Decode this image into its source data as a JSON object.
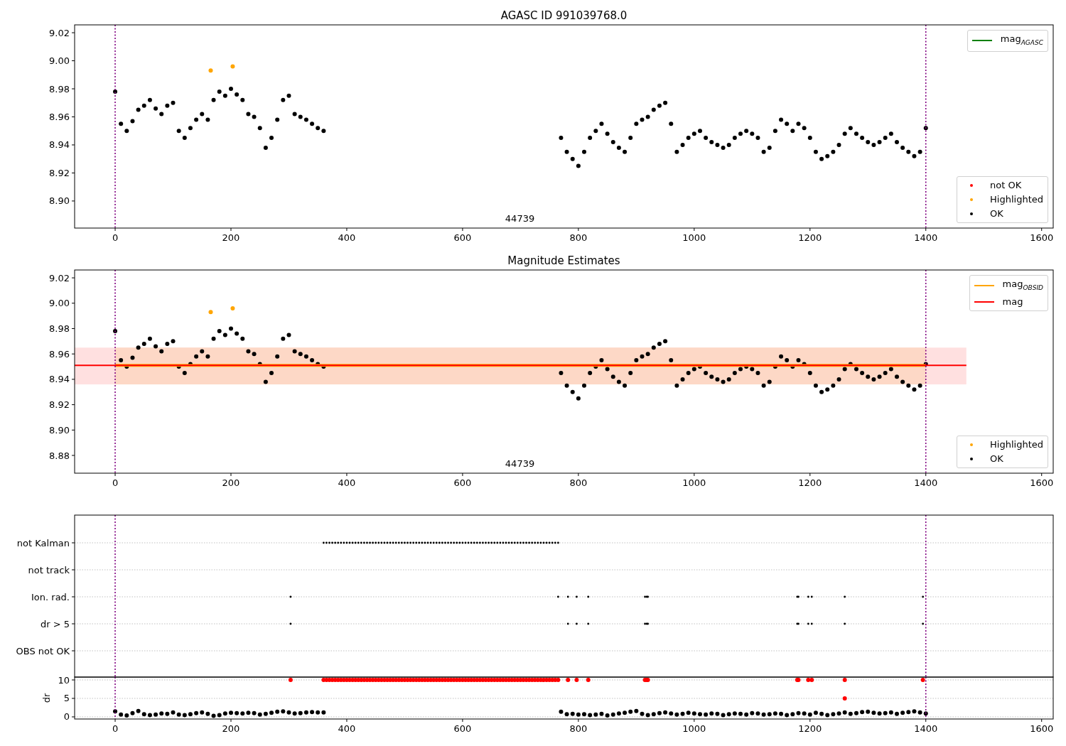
{
  "panels": [
    {
      "kind": "mag",
      "axes": [
        {
          "kind": "mag",
          "chart_data": {
            "type": "scatter",
            "title": "AGASC ID 991039768.0",
            "xlim": [
              -70,
              1620
            ],
            "ylim": [
              8.8807,
              9.0256
            ],
            "xticks": [
              0,
              200,
              400,
              600,
              800,
              1000,
              1200,
              1400,
              1600
            ],
            "yticks": [
              {
                "value": 8.9,
                "label": "8.90"
              },
              {
                "value": 8.92,
                "label": "8.92"
              },
              {
                "value": 8.94,
                "label": "8.94"
              },
              {
                "value": 8.96,
                "label": "8.96"
              },
              {
                "value": 8.98,
                "label": "8.98"
              },
              {
                "value": 9.0,
                "label": "9.00"
              },
              {
                "value": 9.02,
                "label": "9.02"
              }
            ],
            "series": [
              {
                "name": "not OK",
                "type": "scatter",
                "color": "#ff0000"
              },
              {
                "name": "Highlighted",
                "type": "scatter",
                "color": "#ffa500",
                "x": [
                  165,
                  203
                ],
                "values": [
                  8.993,
                  8.996
                ]
              },
              {
                "name": "OK",
                "type": "scatter",
                "color": "#000000",
                "x": [
                  0,
                  10,
                  20,
                  30,
                  40,
                  50,
                  60,
                  70,
                  80,
                  90,
                  100,
                  110,
                  120,
                  130,
                  140,
                  150,
                  160,
                  170,
                  180,
                  190,
                  200,
                  210,
                  220,
                  230,
                  240,
                  250,
                  260,
                  270,
                  280,
                  290,
                  300,
                  310,
                  320,
                  330,
                  340,
                  350,
                  360,
                  770,
                  780,
                  790,
                  800,
                  810,
                  820,
                  830,
                  840,
                  850,
                  860,
                  870,
                  880,
                  890,
                  900,
                  910,
                  920,
                  930,
                  940,
                  950,
                  960,
                  970,
                  980,
                  990,
                  1000,
                  1010,
                  1020,
                  1030,
                  1040,
                  1050,
                  1060,
                  1070,
                  1080,
                  1090,
                  1100,
                  1110,
                  1120,
                  1130,
                  1140,
                  1150,
                  1160,
                  1170,
                  1180,
                  1190,
                  1200,
                  1210,
                  1220,
                  1230,
                  1240,
                  1250,
                  1260,
                  1270,
                  1280,
                  1290,
                  1300,
                  1310,
                  1320,
                  1330,
                  1340,
                  1350,
                  1360,
                  1370,
                  1380,
                  1390,
                  1400
                ],
                "values": [
                  8.978,
                  8.955,
                  8.95,
                  8.957,
                  8.965,
                  8.968,
                  8.972,
                  8.966,
                  8.962,
                  8.968,
                  8.97,
                  8.95,
                  8.945,
                  8.952,
                  8.958,
                  8.962,
                  8.958,
                  8.972,
                  8.978,
                  8.975,
                  8.98,
                  8.976,
                  8.972,
                  8.962,
                  8.96,
                  8.952,
                  8.938,
                  8.945,
                  8.958,
                  8.972,
                  8.975,
                  8.962,
                  8.96,
                  8.958,
                  8.955,
                  8.952,
                  8.95,
                  8.945,
                  8.935,
                  8.93,
                  8.925,
                  8.935,
                  8.945,
                  8.95,
                  8.955,
                  8.948,
                  8.942,
                  8.938,
                  8.935,
                  8.945,
                  8.955,
                  8.958,
                  8.96,
                  8.965,
                  8.968,
                  8.97,
                  8.955,
                  8.935,
                  8.94,
                  8.945,
                  8.948,
                  8.95,
                  8.945,
                  8.942,
                  8.94,
                  8.938,
                  8.94,
                  8.945,
                  8.948,
                  8.95,
                  8.948,
                  8.945,
                  8.935,
                  8.938,
                  8.95,
                  8.958,
                  8.955,
                  8.95,
                  8.955,
                  8.952,
                  8.945,
                  8.935,
                  8.93,
                  8.932,
                  8.935,
                  8.94,
                  8.948,
                  8.952,
                  8.948,
                  8.945,
                  8.942,
                  8.94,
                  8.942,
                  8.945,
                  8.948,
                  8.942,
                  8.938,
                  8.935,
                  8.932,
                  8.935,
                  8.952
                ]
              },
              {
                "name": "mag$_{AGASC}$",
                "type": "line",
                "color": "#008000"
              }
            ],
            "ref_lines": [
              {
                "axis": "x",
                "value": 0
              },
              {
                "axis": "x",
                "value": 1400
              }
            ],
            "annotations": [
              "44739"
            ]
          }
        }
      ]
    },
    {
      "kind": "mag",
      "axes": [
        {
          "kind": "mag",
          "chart_data": {
            "type": "scatter",
            "title": "Magnitude Estimates",
            "xlim": [
              -70,
              1620
            ],
            "ylim": [
              8.866,
              9.0262
            ],
            "xticks": [
              0,
              200,
              400,
              600,
              800,
              1000,
              1200,
              1400,
              1600
            ],
            "yticks": [
              {
                "value": 8.88,
                "label": "8.88"
              },
              {
                "value": 8.9,
                "label": "8.90"
              },
              {
                "value": 8.92,
                "label": "8.92"
              },
              {
                "value": 8.94,
                "label": "8.94"
              },
              {
                "value": 8.96,
                "label": "8.96"
              },
              {
                "value": 8.98,
                "label": "8.98"
              },
              {
                "value": 9.0,
                "label": "9.00"
              },
              {
                "value": 9.02,
                "label": "9.02"
              }
            ],
            "series": [
              {
                "name": "Highlighted",
                "type": "scatter",
                "color": "#ffa500",
                "x": [
                  165,
                  203
                ],
                "values": [
                  8.993,
                  8.996
                ]
              },
              {
                "name": "OK",
                "type": "scatter",
                "color": "#000000",
                "x": [
                  0,
                  10,
                  20,
                  30,
                  40,
                  50,
                  60,
                  70,
                  80,
                  90,
                  100,
                  110,
                  120,
                  130,
                  140,
                  150,
                  160,
                  170,
                  180,
                  190,
                  200,
                  210,
                  220,
                  230,
                  240,
                  250,
                  260,
                  270,
                  280,
                  290,
                  300,
                  310,
                  320,
                  330,
                  340,
                  350,
                  360,
                  770,
                  780,
                  790,
                  800,
                  810,
                  820,
                  830,
                  840,
                  850,
                  860,
                  870,
                  880,
                  890,
                  900,
                  910,
                  920,
                  930,
                  940,
                  950,
                  960,
                  970,
                  980,
                  990,
                  1000,
                  1010,
                  1020,
                  1030,
                  1040,
                  1050,
                  1060,
                  1070,
                  1080,
                  1090,
                  1100,
                  1110,
                  1120,
                  1130,
                  1140,
                  1150,
                  1160,
                  1170,
                  1180,
                  1190,
                  1200,
                  1210,
                  1220,
                  1230,
                  1240,
                  1250,
                  1260,
                  1270,
                  1280,
                  1290,
                  1300,
                  1310,
                  1320,
                  1330,
                  1340,
                  1350,
                  1360,
                  1370,
                  1380,
                  1390,
                  1400
                ],
                "values": [
                  8.978,
                  8.955,
                  8.95,
                  8.957,
                  8.965,
                  8.968,
                  8.972,
                  8.966,
                  8.962,
                  8.968,
                  8.97,
                  8.95,
                  8.945,
                  8.952,
                  8.958,
                  8.962,
                  8.958,
                  8.972,
                  8.978,
                  8.975,
                  8.98,
                  8.976,
                  8.972,
                  8.962,
                  8.96,
                  8.952,
                  8.938,
                  8.945,
                  8.958,
                  8.972,
                  8.975,
                  8.962,
                  8.96,
                  8.958,
                  8.955,
                  8.952,
                  8.95,
                  8.945,
                  8.935,
                  8.93,
                  8.925,
                  8.935,
                  8.945,
                  8.95,
                  8.955,
                  8.948,
                  8.942,
                  8.938,
                  8.935,
                  8.945,
                  8.955,
                  8.958,
                  8.96,
                  8.965,
                  8.968,
                  8.97,
                  8.955,
                  8.935,
                  8.94,
                  8.945,
                  8.948,
                  8.95,
                  8.945,
                  8.942,
                  8.94,
                  8.938,
                  8.94,
                  8.945,
                  8.948,
                  8.95,
                  8.948,
                  8.945,
                  8.935,
                  8.938,
                  8.95,
                  8.958,
                  8.955,
                  8.95,
                  8.955,
                  8.952,
                  8.945,
                  8.935,
                  8.93,
                  8.932,
                  8.935,
                  8.94,
                  8.948,
                  8.952,
                  8.948,
                  8.945,
                  8.942,
                  8.94,
                  8.942,
                  8.945,
                  8.948,
                  8.942,
                  8.938,
                  8.935,
                  8.932,
                  8.935,
                  8.952
                ]
              },
              {
                "name": "mag$_{OBSID}$",
                "type": "line",
                "color": "#ffa500",
                "x": [
                  0,
                  1400
                ],
                "values": [
                  8.951,
                  8.951
                ]
              },
              {
                "name": "mag",
                "type": "line",
                "color": "#ff0000",
                "x": [
                  -70,
                  1470
                ],
                "values": [
                  8.951,
                  8.951
                ]
              }
            ],
            "bands": [
              {
                "axis": "y",
                "from": 8.936,
                "to": 8.965
              },
              {
                "axis": "y",
                "from": 8.936,
                "to": 8.965
              }
            ],
            "ref_lines": [
              {
                "axis": "x",
                "value": 0
              },
              {
                "axis": "x",
                "value": 1400
              }
            ],
            "annotations": [
              "44739"
            ]
          }
        }
      ]
    },
    {
      "kind": "flags",
      "flag_rows": [
        {
          "label": "not Kalman"
        },
        {
          "label": "not track"
        },
        {
          "label": "Ion. rad."
        },
        {
          "label": "dr > 5"
        },
        {
          "label": "OBS not OK"
        }
      ],
      "axes": [
        {
          "kind": "dr",
          "chart_data": {
            "type": "scatter",
            "ylabel": "dr",
            "xlim": [
              -70,
              1620
            ],
            "ylim": [
              -0.58,
              10.77
            ],
            "grid": true,
            "xticks": [
              0,
              200,
              400,
              600,
              800,
              1000,
              1200,
              1400,
              1600
            ],
            "yticks": [
              0,
              5,
              10
            ],
            "series": [
              {
                "type": "scatter",
                "color": "#000000",
                "x": [
                  0,
                  10,
                  20,
                  30,
                  40,
                  50,
                  60,
                  70,
                  80,
                  90,
                  100,
                  110,
                  120,
                  130,
                  140,
                  150,
                  160,
                  170,
                  180,
                  190,
                  200,
                  210,
                  220,
                  230,
                  240,
                  250,
                  260,
                  270,
                  280,
                  290,
                  300,
                  310,
                  320,
                  330,
                  340,
                  350,
                  360,
                  770,
                  780,
                  790,
                  800,
                  810,
                  820,
                  830,
                  840,
                  850,
                  860,
                  870,
                  880,
                  890,
                  900,
                  910,
                  920,
                  930,
                  940,
                  950,
                  960,
                  970,
                  980,
                  990,
                  1000,
                  1010,
                  1020,
                  1030,
                  1040,
                  1050,
                  1060,
                  1070,
                  1080,
                  1090,
                  1100,
                  1110,
                  1120,
                  1130,
                  1140,
                  1150,
                  1160,
                  1170,
                  1180,
                  1190,
                  1200,
                  1210,
                  1220,
                  1230,
                  1240,
                  1250,
                  1260,
                  1270,
                  1280,
                  1290,
                  1300,
                  1310,
                  1320,
                  1330,
                  1340,
                  1350,
                  1360,
                  1370,
                  1380,
                  1390,
                  1400
                ],
                "values": [
                  1.5,
                  0.6,
                  0.4,
                  1.0,
                  1.6,
                  0.7,
                  0.5,
                  0.6,
                  0.9,
                  0.8,
                  1.2,
                  0.6,
                  0.5,
                  0.7,
                  1.0,
                  1.2,
                  0.8,
                  0.3,
                  0.5,
                  0.9,
                  1.1,
                  1.0,
                  0.9,
                  1.1,
                  1.0,
                  0.6,
                  0.8,
                  1.1,
                  1.4,
                  1.5,
                  1.2,
                  0.9,
                  1.0,
                  1.2,
                  1.3,
                  1.2,
                  1.2,
                  1.4,
                  0.7,
                  0.8,
                  0.6,
                  0.7,
                  0.5,
                  0.6,
                  0.8,
                  0.4,
                  0.6,
                  0.9,
                  1.1,
                  1.4,
                  1.6,
                  0.8,
                  0.5,
                  0.7,
                  1.0,
                  1.2,
                  0.9,
                  0.6,
                  0.8,
                  1.1,
                  0.9,
                  0.7,
                  0.6,
                  0.9,
                  0.8,
                  0.5,
                  0.7,
                  0.9,
                  0.8,
                  0.6,
                  1.0,
                  0.9,
                  0.6,
                  0.7,
                  0.9,
                  0.8,
                  0.5,
                  0.7,
                  1.0,
                  0.9,
                  0.6,
                  1.1,
                  0.8,
                  0.5,
                  0.7,
                  0.9,
                  1.2,
                  0.8,
                  1.0,
                  1.3,
                  1.4,
                  1.1,
                  0.9,
                  1.0,
                  1.2,
                  0.8,
                  1.1,
                  1.3,
                  1.5,
                  1.2,
                  0.9
                ]
              },
              {
                "type": "scatter",
                "color": "#ff0000",
                "x": [
                  360,
                  365,
                  370,
                  375,
                  380,
                  385,
                  390,
                  395,
                  400,
                  405,
                  410,
                  415,
                  420,
                  425,
                  430,
                  435,
                  440,
                  445,
                  450,
                  455,
                  460,
                  465,
                  470,
                  475,
                  480,
                  485,
                  490,
                  495,
                  500,
                  505,
                  510,
                  515,
                  520,
                  525,
                  530,
                  535,
                  540,
                  545,
                  550,
                  555,
                  560,
                  565,
                  570,
                  575,
                  580,
                  585,
                  590,
                  595,
                  600,
                  605,
                  610,
                  615,
                  620,
                  625,
                  630,
                  635,
                  640,
                  645,
                  650,
                  655,
                  660,
                  665,
                  670,
                  675,
                  680,
                  685,
                  690,
                  695,
                  700,
                  705,
                  710,
                  715,
                  720,
                  725,
                  730,
                  735,
                  740,
                  745,
                  750,
                  755,
                  760,
                  765,
                  303,
                  782,
                  797,
                  817,
                  915,
                  918,
                  920,
                  1178,
                  1180,
                  1197,
                  1203,
                  1260,
                  1395,
                  1260
                ],
                "values": [
                  10,
                  10,
                  10,
                  10,
                  10,
                  10,
                  10,
                  10,
                  10,
                  10,
                  10,
                  10,
                  10,
                  10,
                  10,
                  10,
                  10,
                  10,
                  10,
                  10,
                  10,
                  10,
                  10,
                  10,
                  10,
                  10,
                  10,
                  10,
                  10,
                  10,
                  10,
                  10,
                  10,
                  10,
                  10,
                  10,
                  10,
                  10,
                  10,
                  10,
                  10,
                  10,
                  10,
                  10,
                  10,
                  10,
                  10,
                  10,
                  10,
                  10,
                  10,
                  10,
                  10,
                  10,
                  10,
                  10,
                  10,
                  10,
                  10,
                  10,
                  10,
                  10,
                  10,
                  10,
                  10,
                  10,
                  10,
                  10,
                  10,
                  10,
                  10,
                  10,
                  10,
                  10,
                  10,
                  10,
                  10,
                  10,
                  10,
                  10,
                  10,
                  10,
                  10,
                  10,
                  10,
                  10,
                  10,
                  10,
                  10,
                  10,
                  10,
                  10,
                  10,
                  10,
                  10,
                  5
                ]
              }
            ],
            "ref_lines": [
              {
                "axis": "x",
                "value": 0
              },
              {
                "axis": "x",
                "value": 1400
              }
            ]
          }
        }
      ]
    }
  ]
}
